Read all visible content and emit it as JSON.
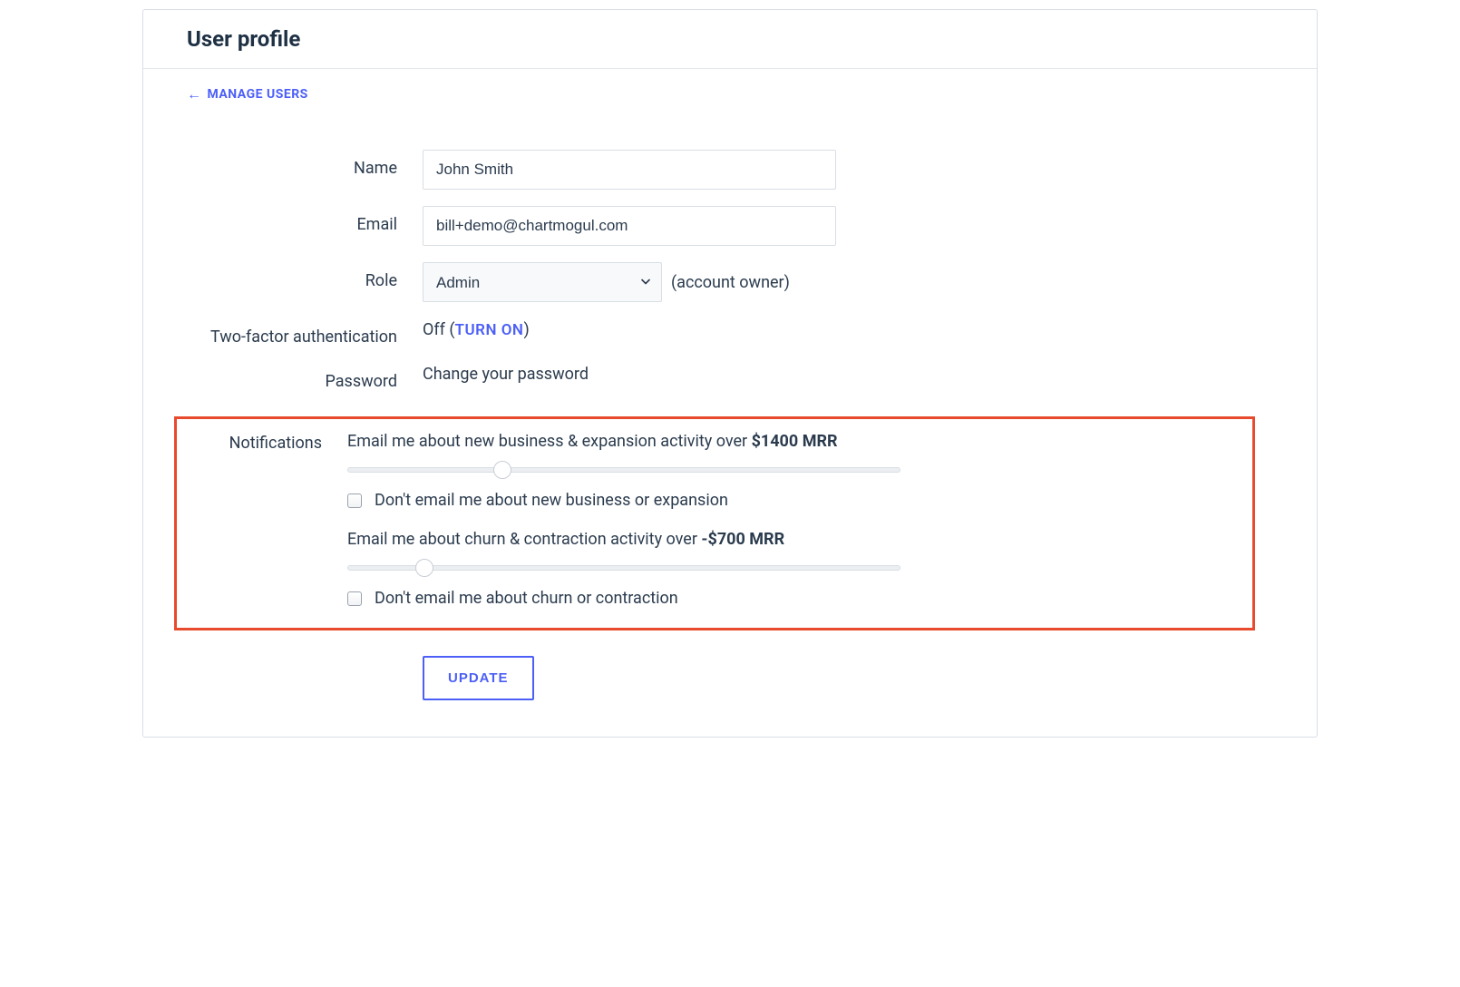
{
  "header": {
    "title": "User profile"
  },
  "back_link": {
    "arrow": "←",
    "label": "Manage Users"
  },
  "fields": {
    "name": {
      "label": "Name",
      "value": "John Smith"
    },
    "email": {
      "label": "Email",
      "value": "bill+demo@chartmogul.com"
    },
    "role": {
      "label": "Role",
      "value": "Admin",
      "note": "(account owner)"
    },
    "twofa": {
      "label": "Two-factor authentication",
      "status_prefix": "Off (",
      "action": "Turn On",
      "status_suffix": ")"
    },
    "password": {
      "label": "Password",
      "text": "Change your password"
    },
    "notifications": {
      "label": "Notifications",
      "expansion": {
        "text_prefix": "Email me about new business & expansion activity over ",
        "threshold": "$1400 MRR",
        "slider_percent": 28,
        "optout_label": "Don't email me about new business or expansion",
        "optout_checked": false
      },
      "churn": {
        "text_prefix": "Email me about churn & contraction activity over ",
        "threshold": "-$700 MRR",
        "slider_percent": 14,
        "optout_label": "Don't email me about churn or contraction",
        "optout_checked": false
      }
    }
  },
  "actions": {
    "update": "Update"
  },
  "colors": {
    "accent": "#4c5ff7",
    "highlight_border": "#e84a2e",
    "text": "#1e3044"
  }
}
